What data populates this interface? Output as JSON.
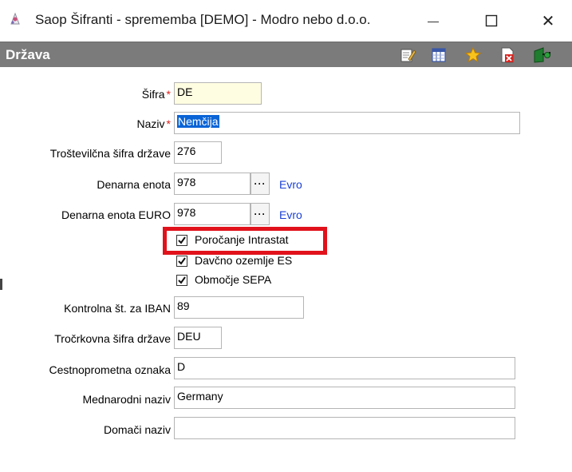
{
  "window": {
    "title": "Saop Šifranti - sprememba [DEMO] - Modro nebo d.o.o.",
    "min_glyph": "—",
    "close_glyph": "✕"
  },
  "header": {
    "title": "Država",
    "toolbar": [
      "edit-icon",
      "columns-icon",
      "favorite-star-icon",
      "delete-icon",
      "exit-icon"
    ]
  },
  "form": {
    "sifra": {
      "label": "Šifra",
      "value": "DE",
      "required": "*"
    },
    "naziv": {
      "label": "Naziv",
      "value": "Nemčija",
      "required": "*"
    },
    "trostevilcna": {
      "label": "Troštevilčna šifra države",
      "value": "276"
    },
    "denarna_enota": {
      "label": "Denarna enota",
      "value": "978",
      "picker": "···",
      "currency_name": "Evro"
    },
    "denarna_enota_euro": {
      "label": "Denarna enota EURO",
      "value": "978",
      "picker": "···",
      "currency_name": "Evro"
    },
    "checkboxes": [
      {
        "label": "Poročanje Intrastat",
        "checked": true
      },
      {
        "label": "Davčno ozemlje ES",
        "checked": true
      },
      {
        "label": "Območje SEPA",
        "checked": true
      }
    ],
    "kontrolna_iban": {
      "label": "Kontrolna št. za  IBAN",
      "value": "89"
    },
    "trocrkovna": {
      "label": "Tročrkovna šifra države",
      "value": "DEU"
    },
    "cestnoprometna": {
      "label": "Cestnoprometna oznaka",
      "value": "D"
    },
    "mednarodni_naziv": {
      "label": "Mednarodni naziv",
      "value": "Germany"
    },
    "domaci_naziv": {
      "label": "Domači naziv",
      "value": ""
    }
  },
  "colors": {
    "header_bg": "#7b7b7b",
    "required": "#e0201b",
    "link": "#1a3fd6",
    "highlight": "#e1121b",
    "yellow_field": "#fffde1"
  }
}
